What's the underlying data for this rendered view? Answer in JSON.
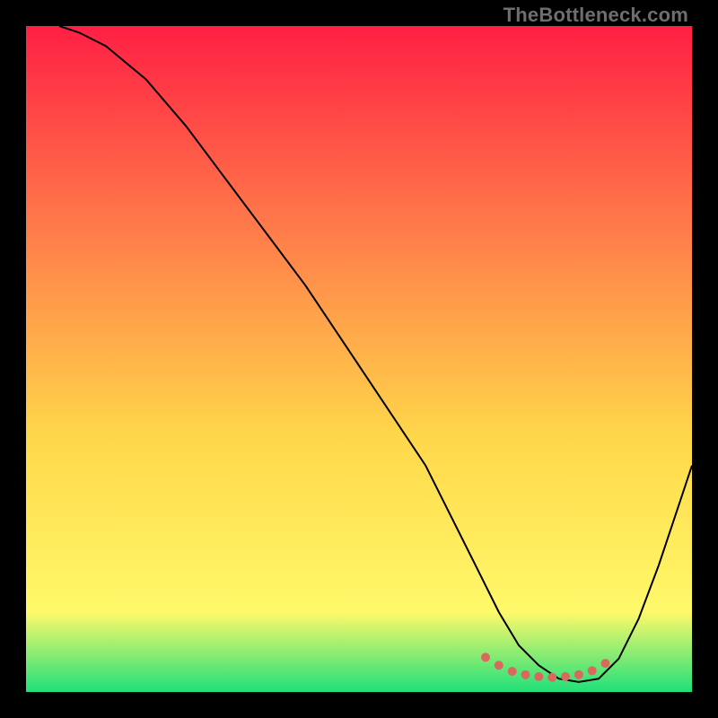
{
  "watermark": "TheBottleneck.com",
  "colors": {
    "background": "#000000",
    "gradient_top": "#ff1f44",
    "gradient_mid_upper": "#ff7a4a",
    "gradient_mid": "#ffd84a",
    "gradient_low": "#fff96a",
    "gradient_bottom": "#1fe07a",
    "curve": "#000000",
    "marker": "#d9695f"
  },
  "chart_data": {
    "type": "line",
    "title": "",
    "xlabel": "",
    "ylabel": "",
    "xlim": [
      0,
      100
    ],
    "ylim": [
      0,
      100
    ],
    "series": [
      {
        "name": "bottleneck-curve",
        "x": [
          5,
          8,
          12,
          18,
          24,
          30,
          36,
          42,
          48,
          54,
          60,
          64,
          68,
          71,
          74,
          77,
          80,
          83,
          86,
          89,
          92,
          95,
          98,
          100
        ],
        "y": [
          100,
          99,
          97,
          92,
          85,
          77,
          69,
          61,
          52,
          43,
          34,
          26,
          18,
          12,
          7,
          4,
          2,
          1.5,
          2,
          5,
          11,
          19,
          28,
          34
        ]
      }
    ],
    "markers": {
      "name": "optimal-zone",
      "x": [
        69,
        71,
        73,
        75,
        77,
        79,
        81,
        83,
        85,
        87
      ],
      "y": [
        5.2,
        4.0,
        3.1,
        2.6,
        2.3,
        2.2,
        2.3,
        2.6,
        3.2,
        4.3
      ]
    }
  }
}
